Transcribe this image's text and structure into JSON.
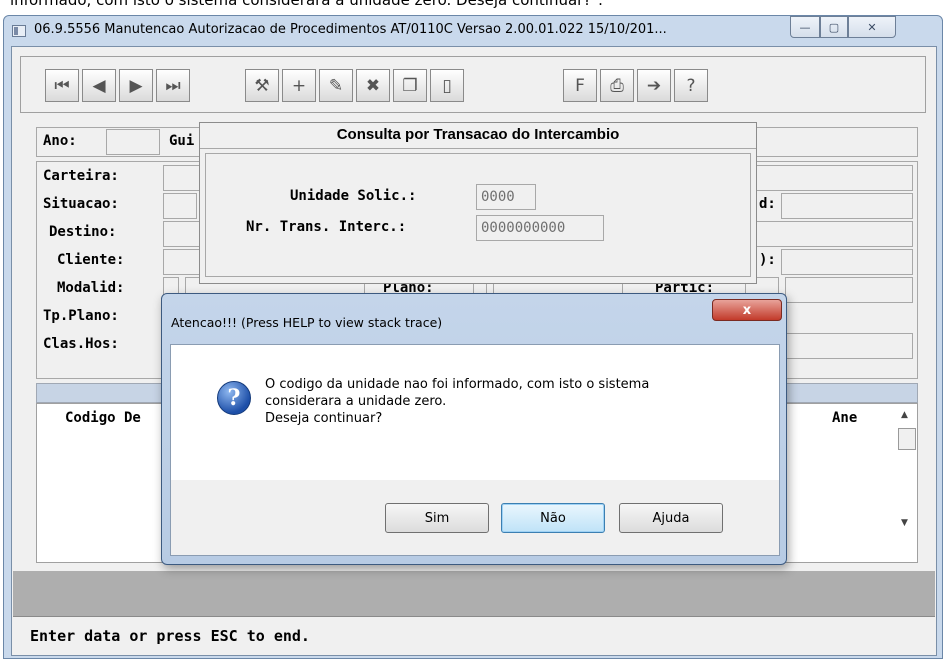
{
  "caption_top": "informado, com isto o sistema considerara a unidade zero. Deseja continuar?\".",
  "window": {
    "title": "06.9.5556 Manutencao Autorizacao de Procedimentos AT/0110C Versao 2.00.01.022 15/10/201...",
    "min_icon": "minimize-icon",
    "max_icon": "maximize-icon",
    "close_icon": "close-icon",
    "min_glyph": "—",
    "max_glyph": "▢",
    "close_glyph": "✕"
  },
  "toolbar": {
    "buttons": [
      {
        "icon": "first-record-icon",
        "glyph": "⏮"
      },
      {
        "icon": "previous-record-icon",
        "glyph": "◀"
      },
      {
        "icon": "next-record-icon",
        "glyph": "▶"
      },
      {
        "icon": "last-record-icon",
        "glyph": "⏭"
      },
      {
        "icon": "search-key-icon",
        "glyph": "⚒"
      },
      {
        "icon": "add-record-icon",
        "glyph": "+"
      },
      {
        "icon": "edit-record-icon",
        "glyph": "✎"
      },
      {
        "icon": "delete-record-icon",
        "glyph": "✖"
      },
      {
        "icon": "copy-record-icon",
        "glyph": "❐"
      },
      {
        "icon": "door-icon",
        "glyph": "▯"
      },
      {
        "icon": "filter-icon",
        "glyph": "F"
      },
      {
        "icon": "print-icon",
        "glyph": "⎙"
      },
      {
        "icon": "exit-icon",
        "glyph": "➔"
      },
      {
        "icon": "help-icon",
        "glyph": "?"
      }
    ]
  },
  "form": {
    "ano_label": "Ano:",
    "gui_label": "Gui",
    "carteira_label": "Carteira:",
    "situacao_label": "Situacao:",
    "destino_label": "Destino:",
    "cliente_label": "Cliente:",
    "modalid_label": "Modalid:",
    "tpplano_label": "Tp.Plano:",
    "claship_label": "Clas.Hos:",
    "plano_label": "Plano:",
    "partic_label": "Partic:",
    "right_label_1": "d:",
    "right_label_2": "):"
  },
  "consulta": {
    "title": "Consulta por Transacao do Intercambio",
    "unidade_label": "Unidade Solic.:",
    "unidade_value": "0000",
    "trans_label": "Nr. Trans. Interc.:",
    "trans_value": "0000000000"
  },
  "grid": {
    "col_codigo": "Codigo De",
    "col_ane": "Ane",
    "scroll_up": "▲",
    "scroll_down": "▼"
  },
  "modal": {
    "title": "Atencao!!! (Press HELP to view stack trace)",
    "close_glyph": "x",
    "icon_glyph": "?",
    "line1": "O codigo da unidade nao foi informado, com isto o sistema",
    "line2": "considerara a unidade zero.",
    "line3": "Deseja continuar?",
    "btn_sim": "Sim",
    "btn_nao": "Não",
    "btn_ajuda": "Ajuda"
  },
  "status": {
    "text": "Enter data or press ESC to end."
  }
}
